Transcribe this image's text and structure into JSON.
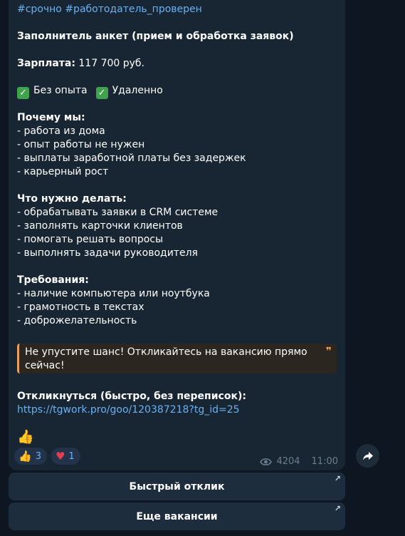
{
  "message": {
    "hashtags": "#срочно #работодатель_проверен",
    "job_title": "Заполнитель анкет (прием и обработка заявок)",
    "salary_label": "Зарплата:",
    "salary_value": " 117 700 руб.",
    "badge_1": "Без опыта",
    "badge_2": "Удаленно",
    "why_heading": "Почему мы:",
    "why_items": [
      "- работа из дома",
      "- опыт работы не нужен",
      "- выплаты заработной платы без задержек",
      "- карьерный рост"
    ],
    "tasks_heading": "Что нужно делать:",
    "tasks_items": [
      "- обрабатывать заявки в CRM системе",
      "- заполнять карточки клиентов",
      "- помогать решать вопросы",
      "- выполнять задачи руководителя"
    ],
    "req_heading": "Требования:",
    "req_items": [
      "- наличие компьютера или ноутбука",
      "- грамотность в текстах",
      "- доброжелательность"
    ],
    "quote_text": "Не упустите шанс! Откликайтесь на вакансию прямо сейчас!",
    "apply_heading": "Откликнуться (быстро, без переписок):",
    "apply_link": "https://tgwork.pro/goo/120387218?tg_id=25",
    "thumb_emoji": "👍"
  },
  "reactions": [
    {
      "emoji": "👍",
      "count": "3"
    },
    {
      "emoji": "♥",
      "count": "1"
    }
  ],
  "meta": {
    "views": "4204",
    "time": "11:00"
  },
  "buttons": {
    "quick_reply": "Быстрый отклик",
    "more_jobs": "Еще вакансии"
  },
  "colors": {
    "background": "#0e1621",
    "bubble": "#182533",
    "link": "#6ab2f2",
    "quote_accent": "#e9a25c"
  },
  "icons": [
    "check-mark-icon",
    "eye-icon",
    "share-arrow-icon",
    "external-arrow-icon",
    "quote-icon"
  ]
}
